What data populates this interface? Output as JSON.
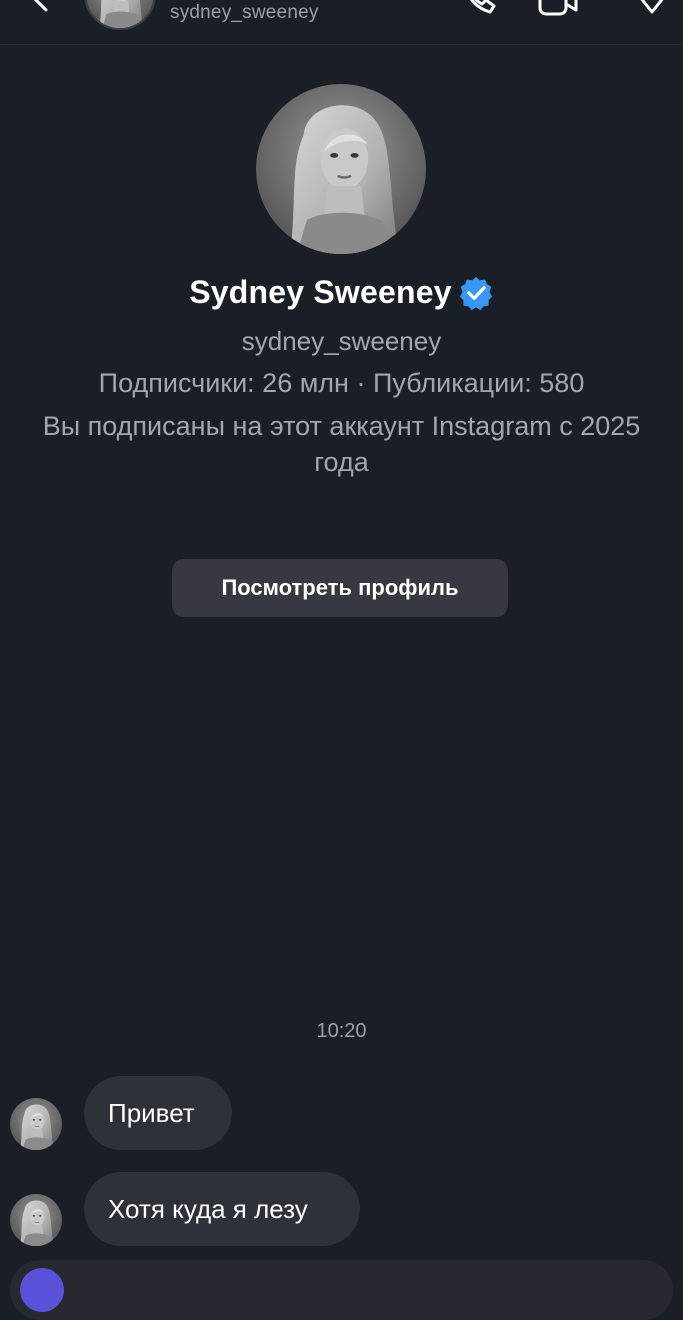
{
  "header": {
    "username": "sydney_sweeney"
  },
  "profile": {
    "name": "Sydney Sweeney",
    "username": "sydney_sweeney",
    "stats": "Подписчики: 26 млн · Публикации: 580",
    "follow_info": "Вы подписаны на этот аккаунт Instagram с 2025 года",
    "view_profile_label": "Посмотреть профиль",
    "verified_color": "#3897f0"
  },
  "chat": {
    "timestamp": "10:20",
    "messages": [
      {
        "text": "Привет"
      },
      {
        "text": "Хотя куда я лезу"
      }
    ]
  },
  "icons": {
    "back": "chevron-left-icon",
    "call": "phone-icon",
    "video": "video-camera-icon",
    "info": "info-icon",
    "verified": "verified-badge-icon"
  }
}
